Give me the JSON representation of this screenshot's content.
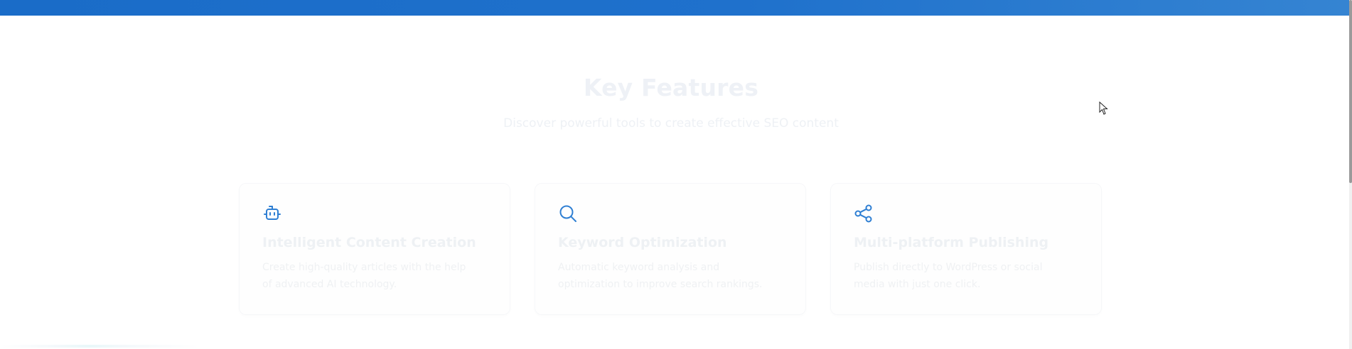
{
  "header": {
    "accent_gradient": [
      "#1a6cc8",
      "#3584d2"
    ]
  },
  "features": {
    "title": "Key Features",
    "subtitle": "Discover powerful tools to create effective SEO content",
    "icon_color": "#2f7fd3",
    "cards": [
      {
        "icon": "robot-icon",
        "title": "Intelligent Content Creation",
        "description": "Create high-quality articles with the help of advanced AI technology."
      },
      {
        "icon": "search-icon",
        "title": "Keyword Optimization",
        "description": "Automatic keyword analysis and optimization to improve search rankings."
      },
      {
        "icon": "share-icon",
        "title": "Multi-platform Publishing",
        "description": "Publish directly to WordPress or social media with just one click."
      }
    ]
  }
}
